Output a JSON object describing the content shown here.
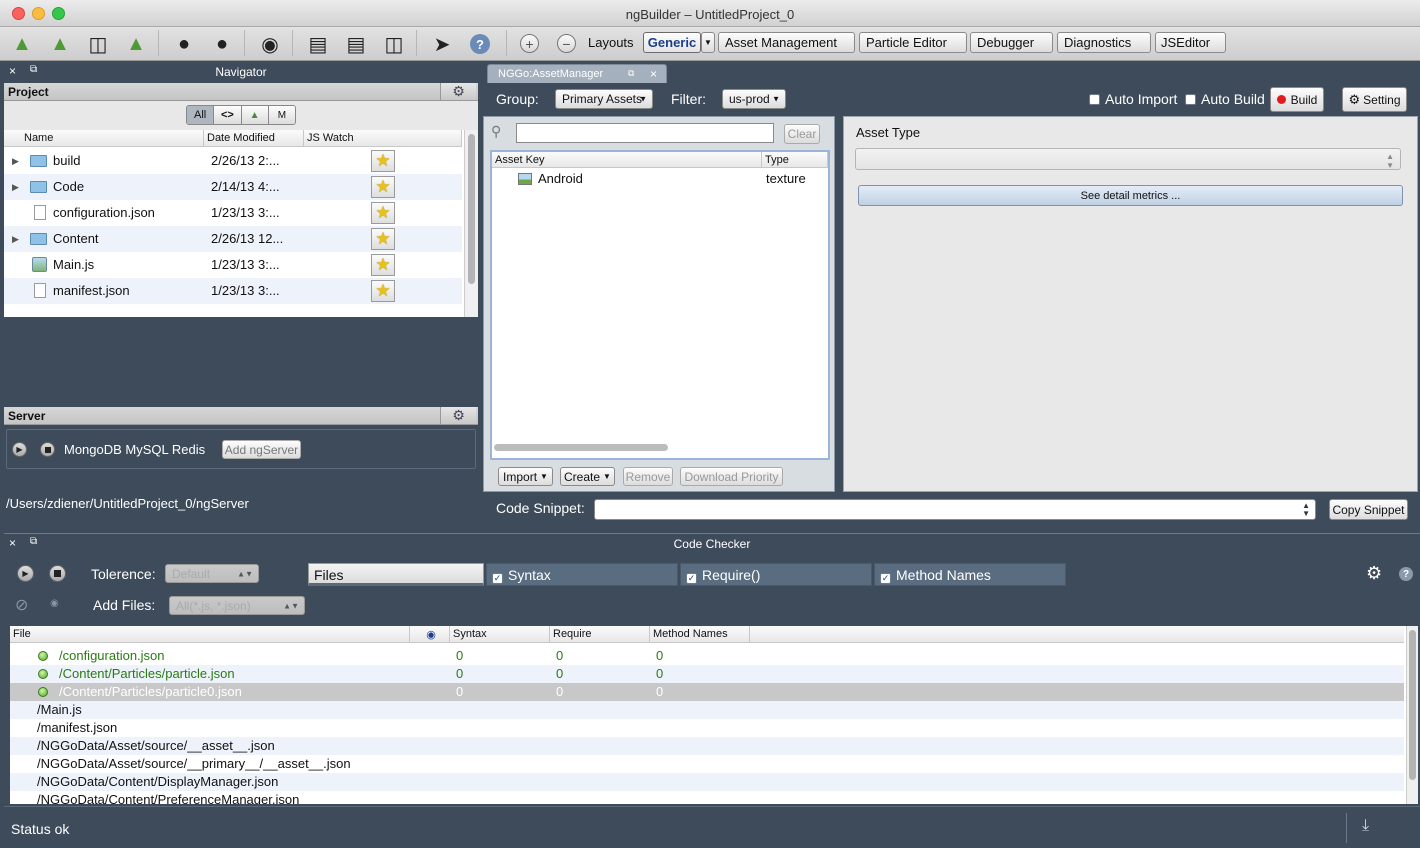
{
  "window": {
    "title": "ngBuilder – UntitledProject_0"
  },
  "toolbar": {
    "layouts_label": "Layouts",
    "tabs": [
      "Generic",
      "Asset Management",
      "Particle Editor",
      "Debugger",
      "Diagnostics",
      "JSEditor"
    ]
  },
  "navigator": {
    "title": "Navigator",
    "project": {
      "label": "Project",
      "filters": [
        "All",
        "<>",
        "▲",
        "M"
      ],
      "columns": [
        "Name",
        "Date Modified",
        "JS Watch"
      ],
      "rows": [
        {
          "name": "build",
          "date": "2/26/13 2:...",
          "kind": "folder"
        },
        {
          "name": "Code",
          "date": "2/14/13 4:...",
          "kind": "folder"
        },
        {
          "name": "configuration.json",
          "date": "1/23/13 3:...",
          "kind": "file"
        },
        {
          "name": "Content",
          "date": "2/26/13 12...",
          "kind": "folder"
        },
        {
          "name": "Main.js",
          "date": "1/23/13 3:...",
          "kind": "script"
        },
        {
          "name": "manifest.json",
          "date": "1/23/13 3:...",
          "kind": "file"
        }
      ]
    },
    "server": {
      "label": "Server",
      "services": "MongoDB MySQL Redis",
      "add_button": "Add ngServer",
      "path": "/Users/zdiener/UntitledProject_0/ngServer"
    }
  },
  "asset_manager": {
    "tab": "NGGo:AssetManager",
    "group_label": "Group:",
    "group_value": "Primary Assets",
    "filter_label": "Filter:",
    "filter_value": "us-prod",
    "auto_import": "Auto Import",
    "auto_build": "Auto Build",
    "build": "Build",
    "setting": "Setting",
    "clear": "Clear",
    "columns": [
      "Asset Key",
      "Type"
    ],
    "rows": [
      {
        "key": "Android",
        "type": "texture"
      }
    ],
    "buttons": {
      "import": "Import",
      "create": "Create",
      "remove": "Remove",
      "download_priority": "Download Priority"
    },
    "asset_type_label": "Asset Type",
    "detail_button": "See detail metrics ...",
    "code_snippet_label": "Code Snippet:",
    "copy_snippet": "Copy Snippet"
  },
  "code_checker": {
    "title": "Code Checker",
    "tolerance_label": "Tolerence:",
    "tolerance_value": "Default",
    "tabs": {
      "files": "Files",
      "syntax": "Syntax",
      "require": "Require()",
      "method_names": "Method Names"
    },
    "add_files_label": "Add Files:",
    "add_files_value": "All(*.js, *.json)",
    "columns": [
      "File",
      "Syntax",
      "Require",
      "Method Names"
    ],
    "rows": [
      {
        "file": "/configuration.json",
        "syntax": "0",
        "require": "0",
        "methods": "0",
        "checked": true,
        "selected": false
      },
      {
        "file": "/Content/Particles/particle.json",
        "syntax": "0",
        "require": "0",
        "methods": "0",
        "checked": true,
        "selected": false
      },
      {
        "file": "/Content/Particles/particle0.json",
        "syntax": "0",
        "require": "0",
        "methods": "0",
        "checked": true,
        "selected": true
      },
      {
        "file": "/Main.js",
        "syntax": "",
        "require": "",
        "methods": "",
        "checked": false,
        "selected": false
      },
      {
        "file": "/manifest.json",
        "syntax": "",
        "require": "",
        "methods": "",
        "checked": false,
        "selected": false
      },
      {
        "file": "/NGGoData/Asset/source/__asset__.json",
        "syntax": "",
        "require": "",
        "methods": "",
        "checked": false,
        "selected": false
      },
      {
        "file": "/NGGoData/Asset/source/__primary__/__asset__.json",
        "syntax": "",
        "require": "",
        "methods": "",
        "checked": false,
        "selected": false
      },
      {
        "file": "/NGGoData/Content/DisplayManager.json",
        "syntax": "",
        "require": "",
        "methods": "",
        "checked": false,
        "selected": false
      },
      {
        "file": "/NGGoData/Content/PreferenceManager.json",
        "syntax": "",
        "require": "",
        "methods": "",
        "checked": false,
        "selected": false
      }
    ]
  },
  "status": {
    "text": "Status ok"
  },
  "colors": {
    "panel": "#3d4b5a",
    "accent": "#1a3f8a",
    "ok": "#2a7a14",
    "selected": "#c8c8c8"
  }
}
